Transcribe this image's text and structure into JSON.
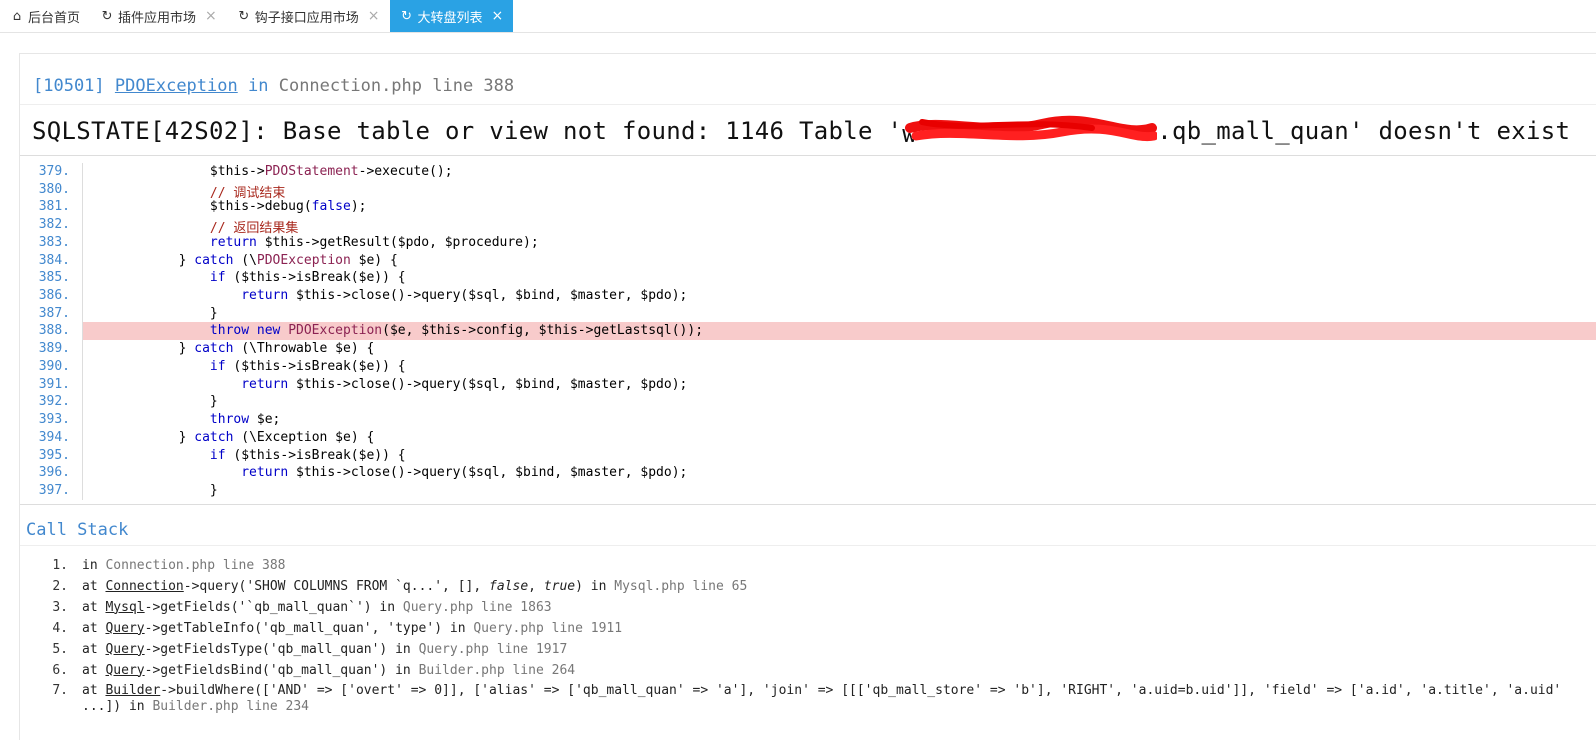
{
  "tabs": [
    {
      "icon": "home-icon",
      "glyph": "⌂",
      "label": "后台首页",
      "closable": false,
      "active": false
    },
    {
      "icon": "refresh-icon",
      "glyph": "↻",
      "label": "插件应用市场",
      "closable": true,
      "active": false
    },
    {
      "icon": "refresh-icon",
      "glyph": "↻",
      "label": "钩子接口应用市场",
      "closable": true,
      "active": false
    },
    {
      "icon": "refresh-icon",
      "glyph": "↻",
      "label": "大转盘列表",
      "closable": true,
      "active": true
    }
  ],
  "close_glyph": "×",
  "exception": {
    "code": "[10501]",
    "class": "PDOException",
    "in": "in",
    "file": "Connection.php line 388"
  },
  "message": {
    "prefix": "SQLSTATE[42S02]: Base table or view not found: 1146 Table '",
    "start_char": "w",
    "suffix": ".qb_mall_quan' doesn't exist"
  },
  "source_lines": [
    {
      "n": "379.",
      "html": "            $this-><span class=\"m\">PDOStatement</span>->execute();"
    },
    {
      "n": "380.",
      "html": "            <span class=\"c\">// 调试结束</span>"
    },
    {
      "n": "381.",
      "html": "            $this->debug(<span class=\"k\">false</span>);"
    },
    {
      "n": "382.",
      "html": "            <span class=\"c\">// 返回结果集</span>"
    },
    {
      "n": "383.",
      "html": "            <span class=\"k\">return</span> $this->getResult($pdo, $procedure);"
    },
    {
      "n": "384.",
      "html": "        } <span class=\"k\">catch</span> (\\<span class=\"m\">PDOException</span> $e) {"
    },
    {
      "n": "385.",
      "html": "            <span class=\"k\">if</span> ($this->isBreak($e)) {"
    },
    {
      "n": "386.",
      "html": "                <span class=\"k\">return</span> $this->close()->query($sql, $bind, $master, $pdo);"
    },
    {
      "n": "387.",
      "html": "            }"
    },
    {
      "n": "388.",
      "html": "            <span class=\"k\">throw new</span> <span class=\"m\">PDOException</span>($e, $this->config, $this->getLastsql());",
      "highlight": true
    },
    {
      "n": "389.",
      "html": "        } <span class=\"k\">catch</span> (\\Throwable $e) {"
    },
    {
      "n": "390.",
      "html": "            <span class=\"k\">if</span> ($this->isBreak($e)) {"
    },
    {
      "n": "391.",
      "html": "                <span class=\"k\">return</span> $this->close()->query($sql, $bind, $master, $pdo);"
    },
    {
      "n": "392.",
      "html": "            }"
    },
    {
      "n": "393.",
      "html": "            <span class=\"k\">throw</span> $e;"
    },
    {
      "n": "394.",
      "html": "        } <span class=\"k\">catch</span> (\\Exception $e) {"
    },
    {
      "n": "395.",
      "html": "            <span class=\"k\">if</span> ($this->isBreak($e)) {"
    },
    {
      "n": "396.",
      "html": "                <span class=\"k\">return</span> $this->close()->query($sql, $bind, $master, $pdo);"
    },
    {
      "n": "397.",
      "html": "            }"
    }
  ],
  "call_stack_title": "Call Stack",
  "call_stack": [
    {
      "n": "1.",
      "html": "in <span class=\"g\">Connection.php line 388</span>"
    },
    {
      "n": "2.",
      "html": "at <span class=\"u\">Connection</span>->query('SHOW COLUMNS FROM `q...', [], <span class=\"i\">false</span>, <span class=\"i\">true</span>) in <span class=\"g\">Mysql.php line 65</span>"
    },
    {
      "n": "3.",
      "html": "at <span class=\"u\">Mysql</span>->getFields('`qb_mall_quan`') in <span class=\"g\">Query.php line 1863</span>"
    },
    {
      "n": "4.",
      "html": "at <span class=\"u\">Query</span>->getTableInfo('qb_mall_quan', 'type') in <span class=\"g\">Query.php line 1911</span>"
    },
    {
      "n": "5.",
      "html": "at <span class=\"u\">Query</span>->getFieldsType('qb_mall_quan') in <span class=\"g\">Query.php line 1917</span>"
    },
    {
      "n": "6.",
      "html": "at <span class=\"u\">Query</span>->getFieldsBind('qb_mall_quan') in <span class=\"g\">Builder.php line 264</span>"
    },
    {
      "n": "7.",
      "html": "at <span class=\"u\">Builder</span>->buildWhere(['AND' => ['overt' => 0]], ['alias' => ['qb_mall_quan' => 'a'], 'join' => [[['qb_mall_store' => 'b'], 'RIGHT', 'a.uid=b.uid']], 'field' => ['a.id', 'a.title', 'a.uid'"
    },
    {
      "n": "",
      "html": "...]) in <span class=\"g\">Builder.php line 234</span>"
    }
  ]
}
